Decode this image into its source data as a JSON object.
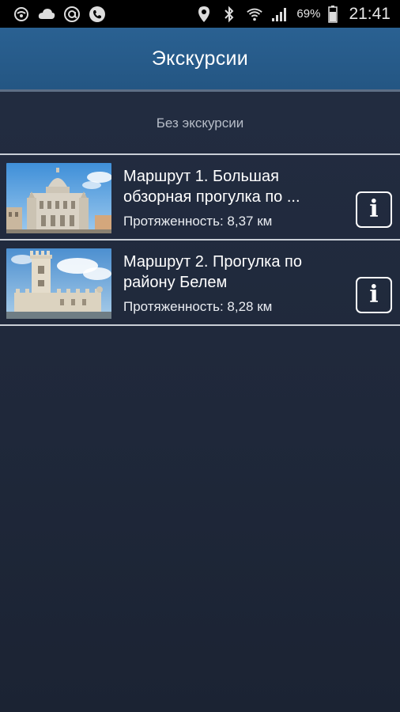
{
  "status_bar": {
    "battery": "69%",
    "time": "21:41",
    "icons_left": [
      "wifi-alt-icon",
      "cloud-icon",
      "at-icon",
      "phone-icon"
    ],
    "icons_right": [
      "location-icon",
      "bluetooth-icon",
      "wifi-icon",
      "signal-icon",
      "battery-icon"
    ]
  },
  "app_bar": {
    "title": "Экскурсии"
  },
  "no_tour": {
    "label": "Без экскурсии"
  },
  "routes": [
    {
      "title": "Маршрут 1. Большая обзорная прогулка по ...",
      "length": "Протяженность: 8,37 км",
      "image": "church-dome-photo"
    },
    {
      "title": "Маршрут 2. Прогулка по району Белем",
      "length": "Протяженность: 8,28 км",
      "image": "tower-photo"
    }
  ],
  "colors": {
    "app_bar": "#2a6192",
    "background": "#1f283a",
    "divider": "#c9ced6"
  }
}
